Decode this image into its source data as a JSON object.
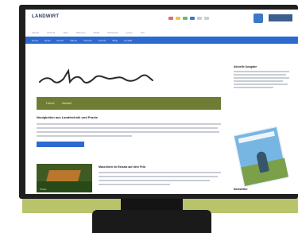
{
  "header": {
    "logo_text": "LANDWIRT",
    "header_dot_colors": [
      "#e06a6a",
      "#f2c24a",
      "#6cb86c",
      "#3b78c8",
      "#c9cdd4",
      "#c9cdd4"
    ]
  },
  "subnav": {
    "items": [
      "Aktuell",
      "Technik",
      "Tiere",
      "Pflanzen",
      "Markt",
      "Wirtschaft",
      "Leben",
      "Abo"
    ]
  },
  "blue_nav": {
    "items": [
      "Home",
      "News",
      "Praxis",
      "Videos",
      "Themen",
      "Events",
      "Shop",
      "Kontakt"
    ]
  },
  "brand_signature": {
    "text": "Landwirt"
  },
  "green_bar": {
    "items": [
      "Home",
      "Aktuell"
    ]
  },
  "article": {
    "title": "Neuigkeiten aus Landtechnik und Praxis",
    "read_more_label": ""
  },
  "second_article": {
    "title": "Maschinen im Einsatz auf dem Feld",
    "thumb_caption": "Praxis"
  },
  "sidebar": {
    "title": "Aktuelle Ausgabe",
    "bottom_title": "Newsletter"
  },
  "colors": {
    "accent_blue": "#2d6ad0",
    "olive_green": "#6f7d34",
    "stand_panel": "#b9c46a",
    "bezel": "#1f1f1f"
  }
}
